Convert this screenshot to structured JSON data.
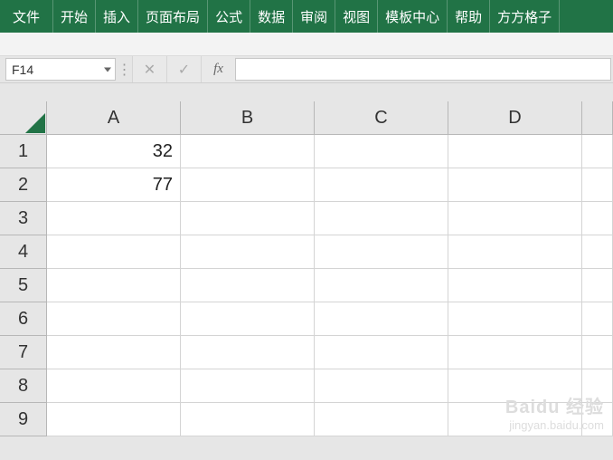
{
  "ribbon": {
    "tabs": [
      "文件",
      "开始",
      "插入",
      "页面布局",
      "公式",
      "数据",
      "审阅",
      "视图",
      "模板中心",
      "帮助",
      "方方格子"
    ]
  },
  "formula": {
    "name_box": "F14",
    "cancel": "✕",
    "confirm": "✓",
    "fx": "fx",
    "input": ""
  },
  "grid": {
    "columns": [
      "A",
      "B",
      "C",
      "D",
      ""
    ],
    "rows": [
      "1",
      "2",
      "3",
      "4",
      "5",
      "6",
      "7",
      "8",
      "9"
    ],
    "cells": {
      "A1": "32",
      "A2": "77"
    }
  },
  "watermark": {
    "brand": "Baidu 经验",
    "sub": "jingyan.baidu.com"
  }
}
